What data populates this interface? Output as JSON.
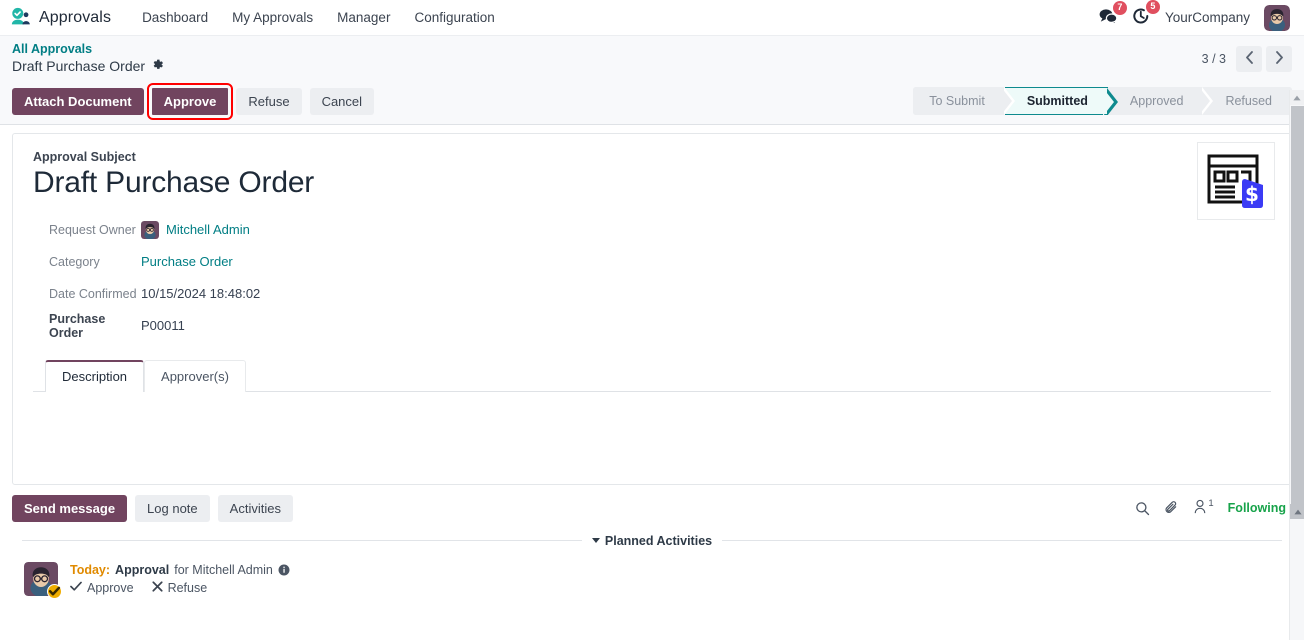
{
  "navbar": {
    "app_icon": "approvals-app-icon",
    "brand": "Approvals",
    "menu": [
      {
        "label": "Dashboard"
      },
      {
        "label": "My Approvals"
      },
      {
        "label": "Manager"
      },
      {
        "label": "Configuration"
      }
    ],
    "messages_icon": "messages-icon",
    "messages_badge": "7",
    "activities_icon": "activity-clock-icon",
    "activities_badge": "5",
    "company": "YourCompany",
    "user_avatar": "user-avatar"
  },
  "breadcrumb": {
    "parent": "All Approvals",
    "current": "Draft Purchase Order",
    "settings_icon": "gear-icon"
  },
  "pager": {
    "count": "3 / 3",
    "prev_icon": "chevron-left-icon",
    "next_icon": "chevron-right-icon"
  },
  "actions": {
    "attach_document": "Attach Document",
    "approve": "Approve",
    "refuse": "Refuse",
    "cancel": "Cancel"
  },
  "statusbar": {
    "steps": [
      {
        "label": "To Submit",
        "active": false
      },
      {
        "label": "Submitted",
        "active": true
      },
      {
        "label": "Approved",
        "active": false
      },
      {
        "label": "Refused",
        "active": false
      }
    ]
  },
  "form": {
    "subject_label": "Approval Subject",
    "subject_value": "Draft Purchase Order",
    "doc_icon": "purchase-order-document-icon",
    "fields": [
      {
        "label": "Request Owner",
        "value": "Mitchell Admin",
        "type": "user",
        "bold_label": false
      },
      {
        "label": "Category",
        "value": "Purchase Order",
        "type": "link",
        "bold_label": false
      },
      {
        "label": "Date Confirmed",
        "value": "10/15/2024 18:48:02",
        "type": "text",
        "bold_label": false
      },
      {
        "label": "Purchase Order",
        "value": "P00011",
        "type": "text",
        "bold_label": true
      }
    ]
  },
  "tabs": [
    {
      "label": "Description",
      "active": true
    },
    {
      "label": "Approver(s)",
      "active": false
    }
  ],
  "tab_content": "",
  "chatter": {
    "send_message": "Send message",
    "log_note": "Log note",
    "activities": "Activities",
    "search_icon": "search-icon",
    "attachment_icon": "paperclip-icon",
    "follower_icon": "follower-person-icon",
    "follower_count": "1",
    "following": "Following"
  },
  "planned": {
    "title": "Planned Activities",
    "caret_icon": "caret-down-icon"
  },
  "activity": {
    "avatar": "mitchell-admin-avatar",
    "badge_icon": "check-circle-badge-icon",
    "today": "Today:",
    "type": "Approval",
    "for_text": "for Mitchell Admin",
    "info_icon": "info-icon",
    "approve": "Approve",
    "approve_icon": "check-icon",
    "refuse": "Refuse",
    "refuse_icon": "x-icon"
  },
  "colors": {
    "primary": "#71445f",
    "link": "#017e84",
    "active_status_border": "#0e8a8e",
    "following_green": "#17a34a",
    "badge_red": "#e04f5f",
    "activity_amber": "#e08a00",
    "focus_red": "#ff0000"
  }
}
